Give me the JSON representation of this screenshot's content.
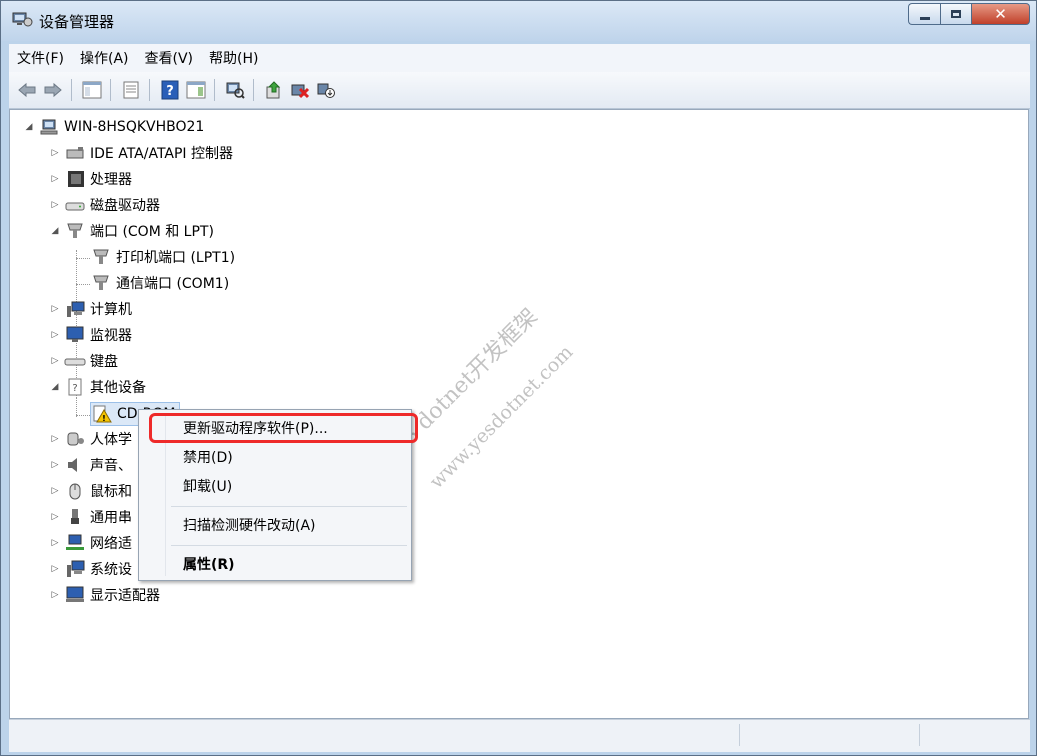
{
  "window": {
    "title": "设备管理器",
    "controls": {
      "minimize": "",
      "maximize": "",
      "close": "✕"
    }
  },
  "menubar": {
    "items": [
      "文件(F)",
      "操作(A)",
      "查看(V)",
      "帮助(H)"
    ]
  },
  "tree": {
    "root": "WIN-8HSQKVHBO21",
    "items": [
      {
        "label": "IDE ATA/ATAPI 控制器",
        "icon": "ide-controller-icon"
      },
      {
        "label": "处理器",
        "icon": "processor-icon"
      },
      {
        "label": "磁盘驱动器",
        "icon": "disk-drive-icon"
      },
      {
        "label": "端口 (COM 和 LPT)",
        "icon": "port-icon"
      },
      {
        "label": "打印机端口 (LPT1)",
        "icon": "port-icon"
      },
      {
        "label": "通信端口 (COM1)",
        "icon": "port-icon"
      },
      {
        "label": "计算机",
        "icon": "computer-icon"
      },
      {
        "label": "监视器",
        "icon": "monitor-icon"
      },
      {
        "label": "键盘",
        "icon": "keyboard-icon"
      },
      {
        "label": "其他设备",
        "icon": "unknown-device-icon"
      },
      {
        "label": "CD-ROM",
        "icon": "warning-device-icon"
      },
      {
        "label": "人体学",
        "icon": "hid-icon"
      },
      {
        "label": "声音、",
        "icon": "sound-icon"
      },
      {
        "label": "鼠标和",
        "icon": "mouse-icon"
      },
      {
        "label": "通用串",
        "icon": "usb-icon"
      },
      {
        "label": "网络适",
        "icon": "network-adapter-icon"
      },
      {
        "label": "系统设",
        "icon": "system-device-icon"
      },
      {
        "label": "显示适配器",
        "icon": "display-adapter-icon"
      }
    ]
  },
  "context_menu": {
    "update_driver": "更新驱动程序软件(P)...",
    "disable": "禁用(D)",
    "uninstall": "卸载(U)",
    "scan_hardware": "扫描检测硬件改动(A)",
    "properties": "属性(R)"
  },
  "watermark": {
    "line1": "YES dotnet开发框架",
    "line2": "www.yesdotnet.com"
  },
  "colors": {
    "highlight_border": "#ee2a2a",
    "titlebar": "#c8daee"
  }
}
